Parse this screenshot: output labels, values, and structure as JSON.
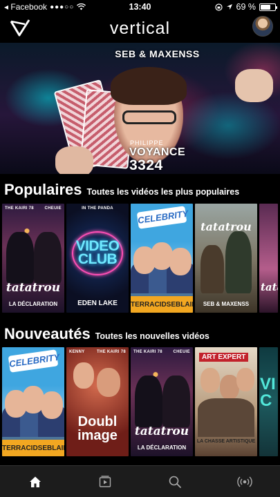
{
  "status_bar": {
    "carrier": "◂ Facebook",
    "signal": "●●●○○",
    "time": "13:40",
    "battery_percent": "69 %",
    "battery_level": 0.69
  },
  "header": {
    "title": "vertical"
  },
  "hero": {
    "creators": "SEB & MAXENSS",
    "subtitle": "PHILIPPE",
    "title": "VOYANCE",
    "number": "3324"
  },
  "sections": [
    {
      "title": "Populaires",
      "subtitle": "Toutes les vidéos les plus populaires",
      "items": [
        {
          "top_left": "THE KAIRI 78",
          "top_right": "CHEUIE",
          "main": "tatatrou",
          "bottom": "LA DÉCLARATION"
        },
        {
          "top_left": "IN THE PANDA",
          "main": "VIDEO CLUB",
          "bottom": "EDEN LAKE"
        },
        {
          "badge": "CELEBRITY",
          "bar": [
            "TERRACID",
            "SEB",
            "LAINK"
          ]
        },
        {
          "main": "tatatrou",
          "bottom": "SEB & MAXENSS"
        },
        {
          "main": "tatatrou"
        }
      ]
    },
    {
      "title": "Nouveautés",
      "subtitle": "Toutes les nouvelles vidéos",
      "items": [
        {
          "badge": "CELEBRITY",
          "bar": [
            "TERRACID",
            "SEB",
            "LAINK"
          ]
        },
        {
          "top_left": "KENNY",
          "top_right": "THE KAIRI 78",
          "main": "Doubl image"
        },
        {
          "top_left": "THE KAIRI 78",
          "top_right": "CHEUIE",
          "main": "tatatrou",
          "bottom": "LA DÉCLARATION"
        },
        {
          "stamp": "ART EXPERT",
          "main": "LA CHASSE ARTISTIQUE"
        },
        {
          "main": "VI C"
        }
      ]
    }
  ],
  "tabs": [
    {
      "name": "home-icon",
      "active": true
    },
    {
      "name": "video-icon",
      "active": false
    },
    {
      "name": "search-icon",
      "active": false
    },
    {
      "name": "live-icon",
      "active": false
    }
  ]
}
